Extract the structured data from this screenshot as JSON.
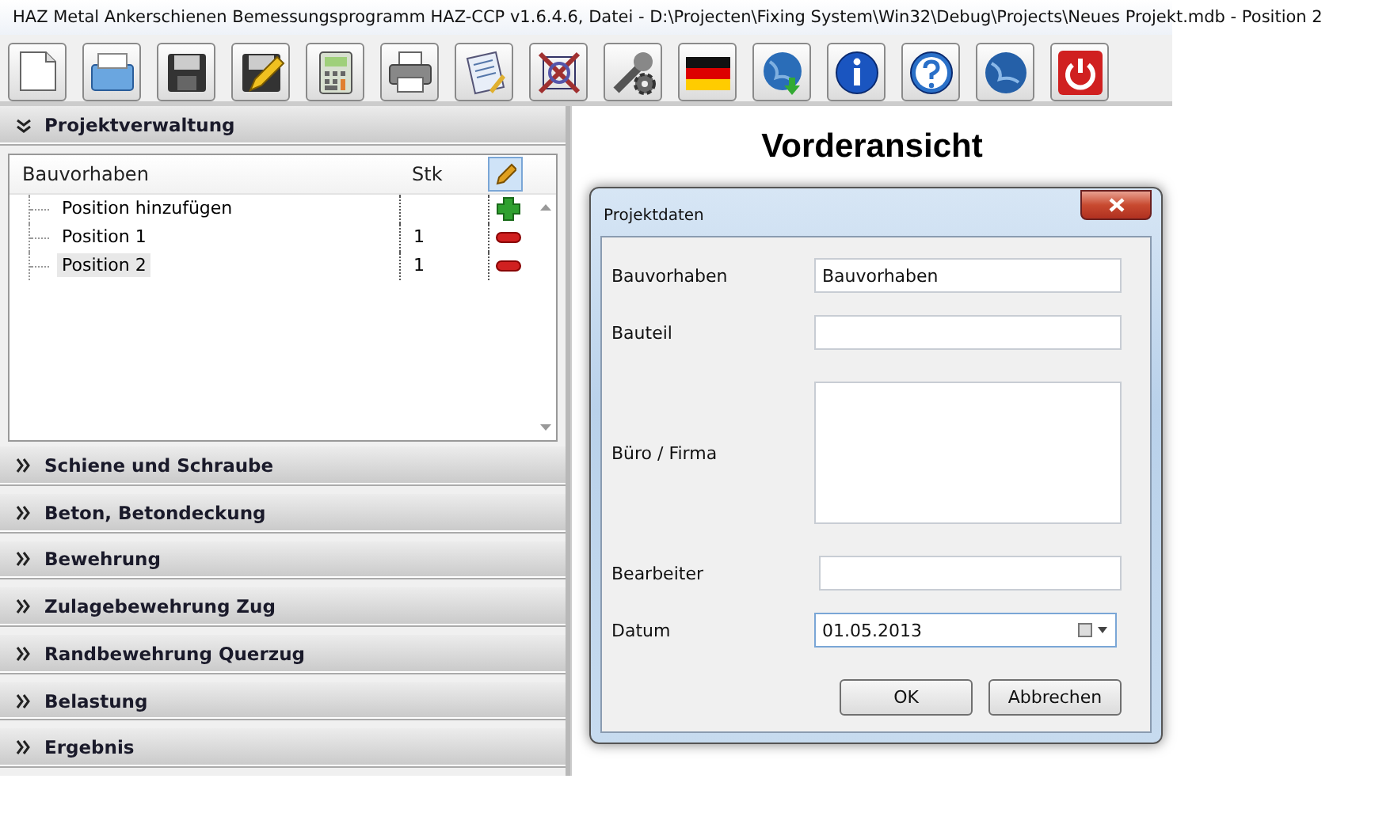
{
  "window": {
    "title": "HAZ Metal Ankerschienen Bemessungsprogramm HAZ-CCP v1.6.4.6, Datei - D:\\Projecten\\Fixing System\\Win32\\Debug\\Projects\\Neues Projekt.mdb - Position 2"
  },
  "toolbar": {
    "buttons": [
      {
        "kind": "new"
      },
      {
        "kind": "open"
      },
      {
        "kind": "save"
      },
      {
        "kind": "edit"
      },
      {
        "kind": "calculator"
      },
      {
        "kind": "print"
      },
      {
        "kind": "report"
      },
      {
        "kind": "drawing"
      },
      {
        "kind": "settings"
      },
      {
        "kind": "language"
      },
      {
        "kind": "update"
      },
      {
        "kind": "info"
      },
      {
        "kind": "help"
      },
      {
        "kind": "web"
      },
      {
        "kind": "exit"
      }
    ]
  },
  "sidebar": {
    "sections": [
      {
        "title": "Projektverwaltung",
        "expanded": true
      },
      {
        "title": "Schiene und Schraube",
        "expanded": false
      },
      {
        "title": "Beton, Betondeckung",
        "expanded": false
      },
      {
        "title": "Bewehrung",
        "expanded": false
      },
      {
        "title": "Zulagebewehrung Zug",
        "expanded": false
      },
      {
        "title": "Randbewehrung Querzug",
        "expanded": false
      },
      {
        "title": "Belastung",
        "expanded": false
      },
      {
        "title": "Ergebnis",
        "expanded": false
      }
    ]
  },
  "project_table": {
    "columns": [
      "Bauvorhaben",
      "Stk"
    ],
    "rows": [
      {
        "label": "Position hinzufügen",
        "kind": "add",
        "selected": false
      },
      {
        "label": "Position 1",
        "count": "1",
        "kind": "remove",
        "selected": false
      },
      {
        "label": "Position 2",
        "count": "1",
        "kind": "remove",
        "selected": true
      }
    ]
  },
  "view": {
    "title": "Vorderansicht"
  },
  "dialog": {
    "title": "Projektdaten",
    "fields": [
      {
        "label": "Bauvorhaben",
        "value": "Bauvorhaben",
        "kind": "text"
      },
      {
        "label": "Bauteil",
        "kind": "text"
      },
      {
        "label": "Büro / Firma",
        "kind": "multiline"
      },
      {
        "label": "Bearbeiter",
        "kind": "text"
      },
      {
        "label": "Datum",
        "value": "01.05.2013",
        "kind": "date"
      }
    ],
    "buttons": [
      "OK",
      "Abbrechen"
    ]
  }
}
